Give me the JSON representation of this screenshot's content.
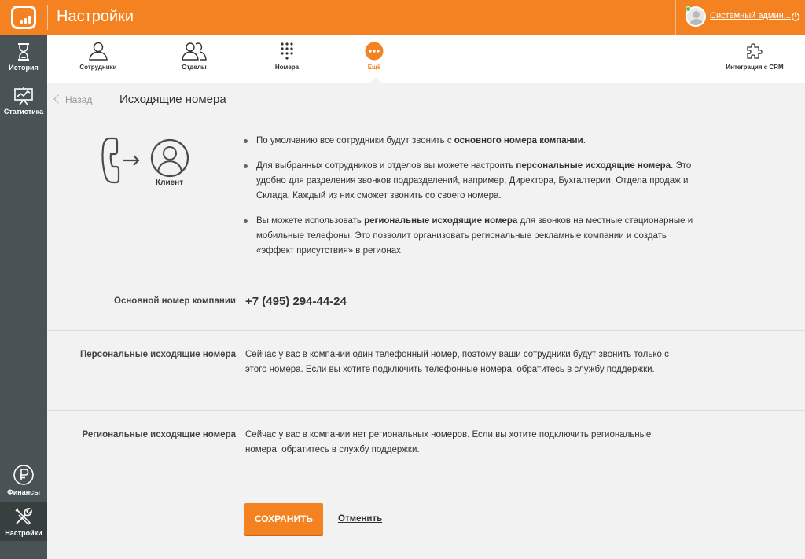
{
  "header": {
    "title": "Настройки",
    "user_name": "Системный админ...",
    "brand_color": "#f58220"
  },
  "sidebar": {
    "items": [
      {
        "label": "История",
        "icon": "hourglass-icon"
      },
      {
        "label": "Статистика",
        "icon": "chart-board-icon"
      },
      {
        "label": "Финансы",
        "icon": "ruble-icon"
      },
      {
        "label": "Настройки",
        "icon": "tools-icon",
        "active": true
      }
    ]
  },
  "tabs": [
    {
      "label": "Сотрудники",
      "icon": "user-icon"
    },
    {
      "label": "Отделы",
      "icon": "users-icon"
    },
    {
      "label": "Номера",
      "icon": "keypad-icon"
    },
    {
      "label": "Ещё",
      "icon": "more-icon",
      "active": true
    },
    {
      "label": "Интеграция с CRM",
      "icon": "puzzle-icon"
    }
  ],
  "subheader": {
    "back_label": "Назад",
    "page_title": "Исходящие номера"
  },
  "info": {
    "client_label": "Клиент",
    "bullets": [
      {
        "parts": [
          "По умолчанию все сотрудники будут звонить с ",
          "основного номера компании",
          "."
        ]
      },
      {
        "parts": [
          "Для выбранных сотрудников и отделов вы можете настроить ",
          "персональные исходящие номера",
          ". Это удобно для разделения звонков подразделений, например, Директора, Бухгалтерии, Отдела продаж и Склада. Каждый из них сможет звонить со своего номера."
        ]
      },
      {
        "parts": [
          "Вы можете использовать ",
          "региональные исходящие номера",
          " для звонков на местные стационарные и мобильные телефоны. Это позволит организовать региональные рекламные компании и создать «эффект присутствия» в регионах."
        ]
      }
    ]
  },
  "settings": {
    "main_number_label": "Основной номер компании",
    "main_number_value": "+7 (495) 294-44-24",
    "personal_label": "Персональные исходящие номера",
    "personal_text": "Сейчас у вас в компании один телефонный номер, поэтому ваши сотрудники будут звонить только с этого номера. Если вы хотите подключить телефонные номера, обратитесь в службу поддержки.",
    "regional_label": "Региональные исходящие номера",
    "regional_text": "Сейчас у вас в компании нет региональных номеров. Если вы хотите подключить региональные номера, обратитесь в службу поддержки."
  },
  "actions": {
    "save_label": "СОХРАНИТЬ",
    "cancel_label": "Отменить"
  }
}
